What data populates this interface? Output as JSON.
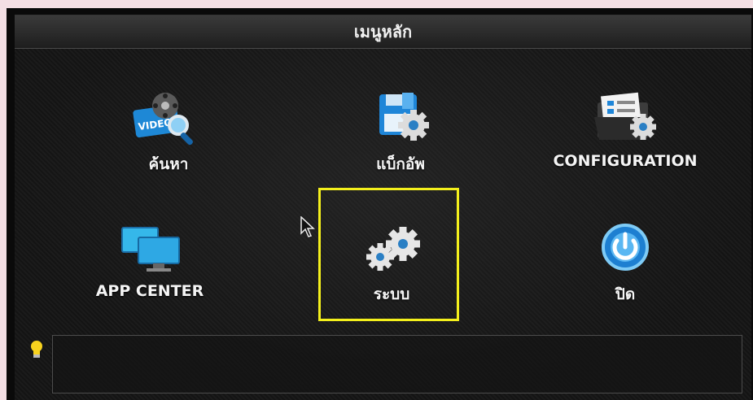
{
  "window": {
    "title": "เมนูหลัก"
  },
  "menu": [
    {
      "id": "search",
      "label": "ค้นหา",
      "icon": "video-search-icon"
    },
    {
      "id": "backup",
      "label": "แบ็กอัพ",
      "icon": "backup-floppy-gear-icon"
    },
    {
      "id": "config",
      "label": "CONFIGURATION",
      "icon": "config-folder-gear-icon"
    },
    {
      "id": "app",
      "label": "APP CENTER",
      "icon": "monitors-icon"
    },
    {
      "id": "system",
      "label": "ระบบ",
      "icon": "gears-icon"
    },
    {
      "id": "off",
      "label": "ปิด",
      "icon": "power-icon"
    }
  ],
  "hint": {
    "text": ""
  },
  "colors": {
    "highlight": "#f4f01c",
    "background": "#141414",
    "accent": "#2a8fe0"
  }
}
